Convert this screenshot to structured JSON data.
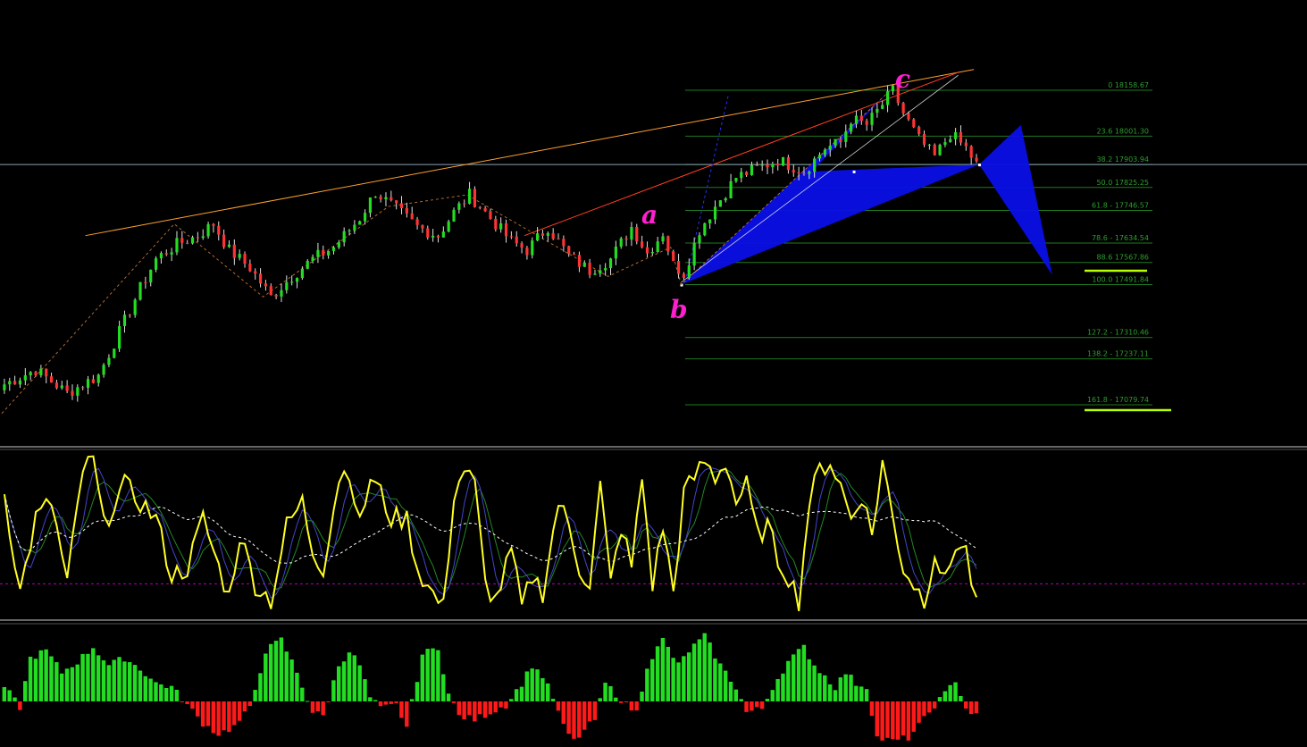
{
  "colors": {
    "background": "#000000",
    "bull_candle": "#22dd22",
    "bear_candle": "#ff3333",
    "wick": "#e0e0e0",
    "fib_line": "#1f7a1f",
    "fib_text": "#2e9e2e",
    "price_line": "#8aa0b4",
    "pattern_fill": "#0a0fe6",
    "wave_label": "#ff1fd0",
    "trend_orange": "#ffa030",
    "trend_red": "#ff4020",
    "zigzag": "#b06a30",
    "highlight": "#b5ff00",
    "osc_main": "#ffff22",
    "osc_blue": "#4444cc",
    "osc_green": "#228822",
    "osc_signal": "#ffffff",
    "osc_level": "#b000b0",
    "hist_pos": "#22dd22",
    "hist_neg": "#ff1a1a",
    "separator": "#cccccc"
  },
  "wave_labels": [
    {
      "id": "a",
      "text": "a"
    },
    {
      "id": "b",
      "text": "b"
    },
    {
      "id": "c",
      "text": "c"
    }
  ],
  "chart_data": [
    {
      "type": "candlestick",
      "title": "",
      "current_price": 17903.94,
      "fib_levels": [
        {
          "ratio": 0,
          "price": 18158.67,
          "label": "0 18158.67"
        },
        {
          "ratio": 23.6,
          "price": 18001.3,
          "label": "23.6 18001.30"
        },
        {
          "ratio": 38.2,
          "price": 17903.94,
          "label": "38.2 17903.94"
        },
        {
          "ratio": 50.0,
          "price": 17825.25,
          "label": "50.0 17825.25"
        },
        {
          "ratio": 61.8,
          "price": 17746.57,
          "label": "61.8 - 17746.57"
        },
        {
          "ratio": 78.6,
          "price": 17634.54,
          "label": "78.6 - 17634.54"
        },
        {
          "ratio": 88.6,
          "price": 17567.86,
          "label": "88.6 17567.86"
        },
        {
          "ratio": 100.0,
          "price": 17491.84,
          "label": "100.0 17491.84"
        },
        {
          "ratio": 127.2,
          "price": 17310.46,
          "label": "127.2 - 17310.46"
        },
        {
          "ratio": 138.2,
          "price": 17237.11,
          "label": "138.2 - 17237.11"
        },
        {
          "ratio": 161.8,
          "price": 17079.74,
          "label": "161.8 - 17079.74"
        }
      ],
      "close_path": [
        [
          0,
          17150
        ],
        [
          6,
          17200
        ],
        [
          12,
          17120
        ],
        [
          18,
          17180
        ],
        [
          22,
          17330
        ],
        [
          26,
          17480
        ],
        [
          29,
          17580
        ],
        [
          33,
          17630
        ],
        [
          37,
          17660
        ],
        [
          40,
          17700
        ],
        [
          43,
          17610
        ],
        [
          47,
          17550
        ],
        [
          51,
          17450
        ],
        [
          55,
          17520
        ],
        [
          59,
          17580
        ],
        [
          63,
          17620
        ],
        [
          68,
          17720
        ],
        [
          71,
          17810
        ],
        [
          75,
          17750
        ],
        [
          79,
          17690
        ],
        [
          83,
          17660
        ],
        [
          86,
          17740
        ],
        [
          89,
          17800
        ],
        [
          93,
          17720
        ],
        [
          97,
          17640
        ],
        [
          100,
          17610
        ],
        [
          104,
          17690
        ],
        [
          108,
          17590
        ],
        [
          112,
          17540
        ],
        [
          116,
          17580
        ],
        [
          120,
          17690
        ],
        [
          123,
          17600
        ],
        [
          126,
          17670
        ],
        [
          128,
          17560
        ],
        [
          130,
          17530
        ],
        [
          133,
          17680
        ],
        [
          136,
          17760
        ],
        [
          140,
          17860
        ],
        [
          144,
          17890
        ],
        [
          148,
          17920
        ],
        [
          153,
          17880
        ],
        [
          157,
          17960
        ],
        [
          160,
          17980
        ],
        [
          162,
          18060
        ],
        [
          165,
          18040
        ],
        [
          168,
          18110
        ],
        [
          170,
          18158
        ],
        [
          172,
          18080
        ],
        [
          175,
          17990
        ],
        [
          178,
          17930
        ],
        [
          181,
          18010
        ],
        [
          184,
          17960
        ],
        [
          186,
          17904
        ]
      ]
    },
    {
      "type": "line",
      "title": "",
      "level": 20,
      "ylim": [
        0,
        100
      ],
      "main_path": [
        [
          0,
          75
        ],
        [
          3,
          15
        ],
        [
          6,
          60
        ],
        [
          9,
          70
        ],
        [
          12,
          20
        ],
        [
          15,
          90
        ],
        [
          17,
          95
        ],
        [
          19,
          55
        ],
        [
          21,
          70
        ],
        [
          23,
          80
        ],
        [
          26,
          70
        ],
        [
          29,
          60
        ],
        [
          32,
          25
        ],
        [
          35,
          30
        ],
        [
          38,
          60
        ],
        [
          41,
          30
        ],
        [
          43,
          12
        ],
        [
          45,
          50
        ],
        [
          48,
          20
        ],
        [
          51,
          10
        ],
        [
          54,
          55
        ],
        [
          57,
          70
        ],
        [
          59,
          40
        ],
        [
          61,
          30
        ],
        [
          64,
          85
        ],
        [
          66,
          90
        ],
        [
          68,
          55
        ],
        [
          70,
          85
        ],
        [
          72,
          75
        ],
        [
          74,
          60
        ],
        [
          77,
          60
        ],
        [
          79,
          30
        ],
        [
          81,
          18
        ],
        [
          84,
          5
        ],
        [
          86,
          75
        ],
        [
          88,
          90
        ],
        [
          90,
          80
        ],
        [
          92,
          20
        ],
        [
          94,
          10
        ],
        [
          97,
          40
        ],
        [
          99,
          5
        ],
        [
          101,
          25
        ],
        [
          103,
          15
        ],
        [
          106,
          70
        ],
        [
          108,
          55
        ],
        [
          110,
          30
        ],
        [
          112,
          20
        ],
        [
          114,
          80
        ],
        [
          116,
          20
        ],
        [
          118,
          55
        ],
        [
          120,
          30
        ],
        [
          122,
          85
        ],
        [
          124,
          20
        ],
        [
          126,
          55
        ],
        [
          128,
          15
        ],
        [
          130,
          75
        ],
        [
          132,
          85
        ],
        [
          134,
          95
        ],
        [
          136,
          85
        ],
        [
          138,
          95
        ],
        [
          140,
          70
        ],
        [
          142,
          80
        ],
        [
          144,
          50
        ],
        [
          146,
          55
        ],
        [
          148,
          35
        ],
        [
          150,
          25
        ],
        [
          152,
          10
        ],
        [
          154,
          70
        ],
        [
          156,
          90
        ],
        [
          158,
          95
        ],
        [
          160,
          80
        ],
        [
          162,
          60
        ],
        [
          164,
          75
        ],
        [
          166,
          50
        ],
        [
          168,
          95
        ],
        [
          170,
          60
        ],
        [
          172,
          30
        ],
        [
          174,
          20
        ],
        [
          176,
          10
        ],
        [
          178,
          40
        ],
        [
          180,
          20
        ],
        [
          182,
          45
        ],
        [
          184,
          40
        ],
        [
          186,
          5
        ]
      ]
    },
    {
      "type": "bar",
      "title": "",
      "ylim": [
        -60,
        90
      ],
      "histogram_path": [
        [
          0,
          20
        ],
        [
          3,
          -8
        ],
        [
          5,
          60
        ],
        [
          8,
          70
        ],
        [
          11,
          40
        ],
        [
          14,
          55
        ],
        [
          17,
          75
        ],
        [
          20,
          50
        ],
        [
          23,
          60
        ],
        [
          26,
          45
        ],
        [
          29,
          25
        ],
        [
          32,
          20
        ],
        [
          35,
          -5
        ],
        [
          38,
          -30
        ],
        [
          41,
          -45
        ],
        [
          44,
          -35
        ],
        [
          47,
          -10
        ],
        [
          50,
          70
        ],
        [
          53,
          85
        ],
        [
          56,
          40
        ],
        [
          59,
          -15
        ],
        [
          61,
          -20
        ],
        [
          64,
          50
        ],
        [
          66,
          70
        ],
        [
          68,
          50
        ],
        [
          70,
          5
        ],
        [
          72,
          -10
        ],
        [
          75,
          -5
        ],
        [
          77,
          -35
        ],
        [
          80,
          65
        ],
        [
          83,
          75
        ],
        [
          85,
          10
        ],
        [
          87,
          -20
        ],
        [
          90,
          -25
        ],
        [
          93,
          -15
        ],
        [
          96,
          -5
        ],
        [
          99,
          25
        ],
        [
          101,
          50
        ],
        [
          103,
          35
        ],
        [
          105,
          5
        ],
        [
          107,
          -35
        ],
        [
          109,
          -55
        ],
        [
          111,
          -40
        ],
        [
          113,
          -25
        ],
        [
          115,
          25
        ],
        [
          117,
          10
        ],
        [
          119,
          -5
        ],
        [
          121,
          -15
        ],
        [
          123,
          50
        ],
        [
          126,
          85
        ],
        [
          129,
          50
        ],
        [
          131,
          70
        ],
        [
          134,
          90
        ],
        [
          137,
          50
        ],
        [
          140,
          20
        ],
        [
          142,
          -15
        ],
        [
          145,
          -10
        ],
        [
          147,
          20
        ],
        [
          150,
          55
        ],
        [
          153,
          75
        ],
        [
          155,
          50
        ],
        [
          157,
          35
        ],
        [
          159,
          20
        ],
        [
          161,
          40
        ],
        [
          163,
          25
        ],
        [
          165,
          20
        ],
        [
          167,
          -50
        ],
        [
          170,
          -55
        ],
        [
          173,
          -50
        ],
        [
          176,
          -25
        ],
        [
          178,
          -5
        ],
        [
          180,
          10
        ],
        [
          182,
          30
        ],
        [
          184,
          -10
        ],
        [
          186,
          -20
        ]
      ]
    }
  ]
}
